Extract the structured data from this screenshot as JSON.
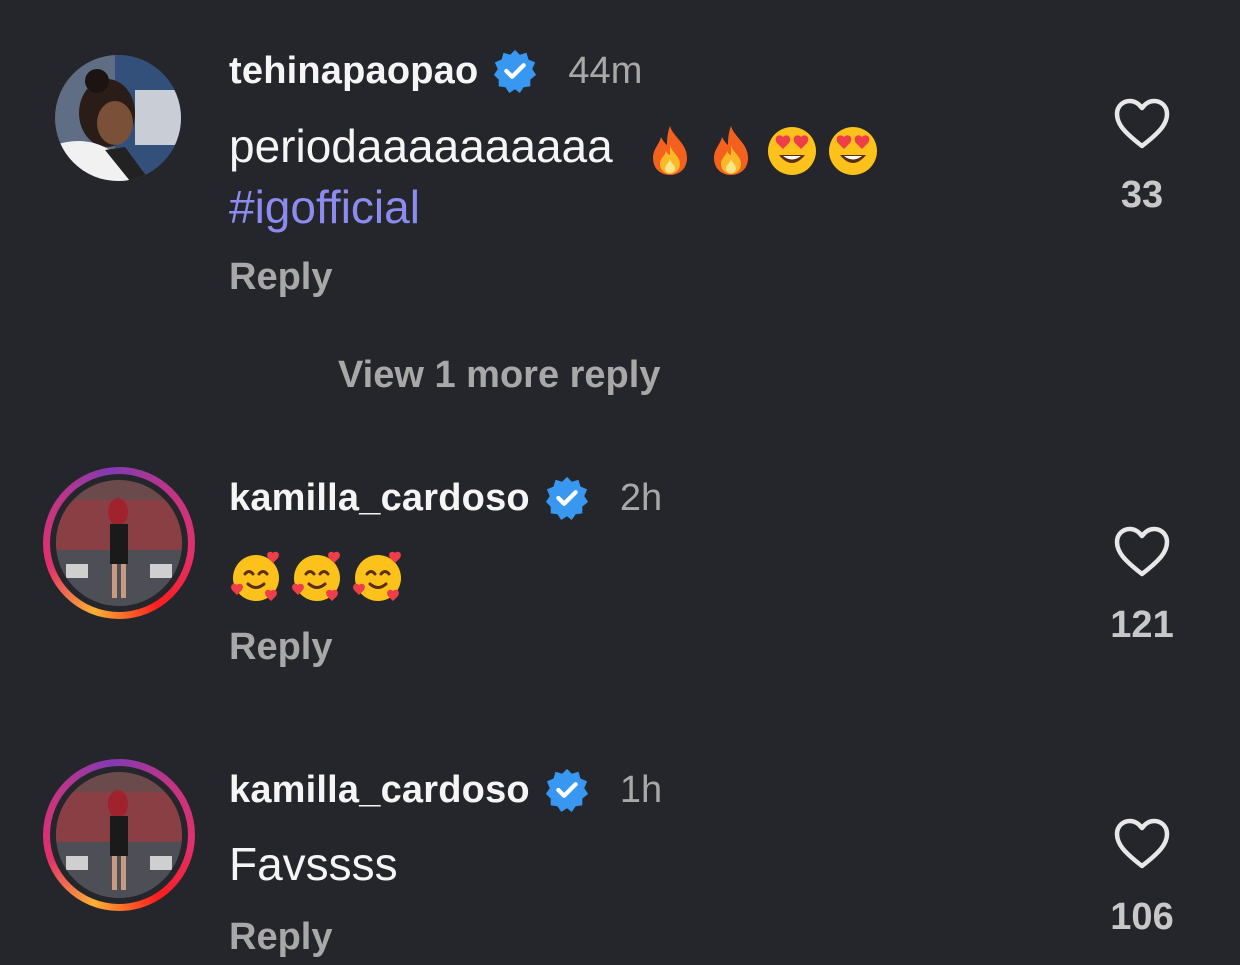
{
  "comments": [
    {
      "username": "tehinapaopao",
      "verified": true,
      "time": "44m",
      "text": "periodaaaaaaaaaa",
      "emojis": [
        "fire-emoji",
        "fire-emoji",
        "heart-eyes-emoji",
        "heart-eyes-emoji"
      ],
      "hashtag": "#igofficial",
      "reply_label": "Reply",
      "likes": "33",
      "avatar": "photo"
    },
    {
      "username": "kamilla_cardoso",
      "verified": true,
      "time": "2h",
      "text": "",
      "emojis": [
        "smiling-hearts-emoji",
        "smiling-hearts-emoji",
        "smiling-hearts-emoji"
      ],
      "reply_label": "Reply",
      "likes": "121",
      "avatar": "photo-with-story-ring"
    },
    {
      "username": "kamilla_cardoso",
      "verified": true,
      "time": "1h",
      "text": "Favssss",
      "reply_label": "Reply",
      "likes": "106",
      "avatar": "photo-with-story-ring"
    }
  ],
  "view_more_replies": "View 1 more reply",
  "colors": {
    "background": "#25262b",
    "verified": "#3897f0",
    "hashtag": "#8c8cf0",
    "muted": "#a8a8a8"
  }
}
